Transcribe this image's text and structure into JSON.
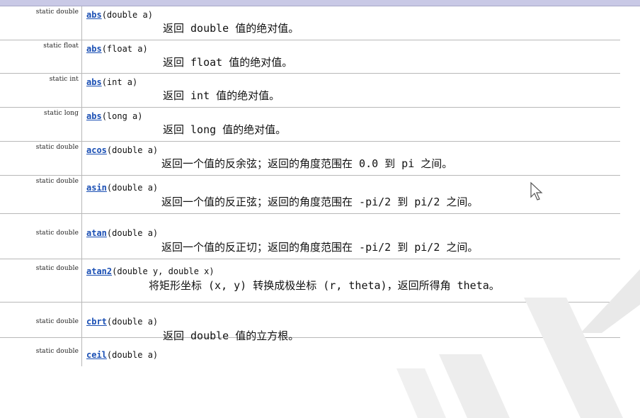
{
  "methods": [
    {
      "modifier": "static double",
      "name": "abs",
      "params": "(double a)",
      "desc": "返回 double 值的绝对值。"
    },
    {
      "modifier": "static float",
      "name": "abs",
      "params": "(float a)",
      "desc": "返回 float 值的绝对值。"
    },
    {
      "modifier": "static int",
      "name": "abs",
      "params": "(int a)",
      "desc": "返回 int 值的绝对值。"
    },
    {
      "modifier": "static long",
      "name": "abs",
      "params": "(long a)",
      "desc": "返回 long 值的绝对值。"
    },
    {
      "modifier": "static double",
      "name": "acos",
      "params": "(double a)",
      "desc": "返回一个值的反余弦；返回的角度范围在 0.0 到 pi 之间。"
    },
    {
      "modifier": "static double",
      "name": "asin",
      "params": "(double a)",
      "desc": "返回一个值的反正弦；返回的角度范围在 -pi/2 到 pi/2 之间。"
    },
    {
      "modifier": "static double",
      "name": "atan",
      "params": "(double a)",
      "desc": "返回一个值的反正切；返回的角度范围在 -pi/2 到 pi/2 之间。"
    },
    {
      "modifier": "static double",
      "name": "atan2",
      "params": "(double y, double x)",
      "desc": "将矩形坐标 (x, y) 转换成极坐标 (r, theta)，返回所得角 theta。"
    },
    {
      "modifier": "static double",
      "name": "cbrt",
      "params": "(double a)",
      "desc": "返回 double 值的立方根。"
    },
    {
      "modifier": "static double",
      "name": "ceil",
      "params": "(double a)",
      "desc": ""
    }
  ],
  "colors": {
    "link": "#1a4fb4",
    "border": "#b8b8b8",
    "header_bar": "#c9c9e6",
    "watermark": "#e6e6e6"
  },
  "icons": {
    "cursor": "arrow-cursor-icon"
  }
}
